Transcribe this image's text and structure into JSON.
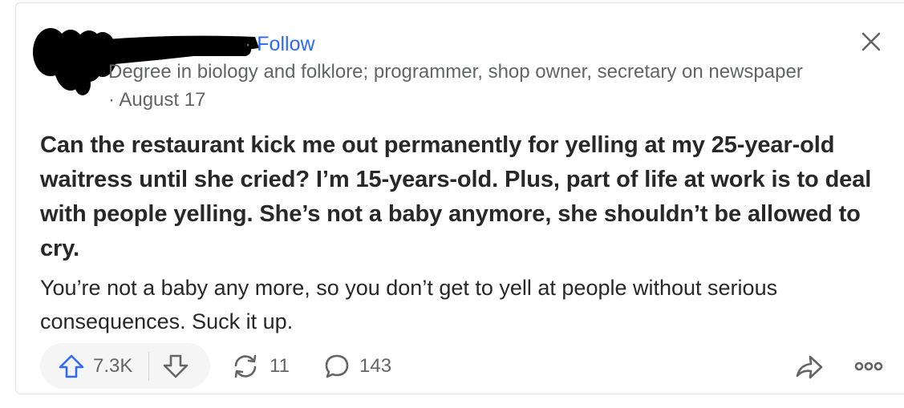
{
  "author": {
    "name_redacted": true,
    "separator": "·",
    "follow_label": "Follow",
    "credential": "Degree in biology and folklore; programmer, shop owner, secretary on newspaper",
    "date": "· August 17"
  },
  "question": {
    "text": "Can the restaurant kick me out permanently for yelling at my 25-year-old waitress until she cried? I’m 15-years-old. Plus, part of life at work is to deal with people yelling. She’s not a baby anymore, she shouldn’t be allowed to cry."
  },
  "answer": {
    "text": "You’re not a baby any more, so you don’t get to yell at people without serious consequences. Suck it up."
  },
  "actions": {
    "upvote_count": "7.3K",
    "reshare_count": "11",
    "comment_count": "143"
  },
  "icons": {
    "close": "close-icon",
    "upvote": "upvote-arrow-icon",
    "downvote": "downvote-arrow-icon",
    "reshare": "reshare-icon",
    "comment": "comment-bubble-icon",
    "share": "share-arrow-icon",
    "more": "more-options-icon"
  },
  "colors": {
    "accent": "#2e69ff",
    "text_primary": "#282829",
    "text_secondary": "#636466",
    "pill_bg": "#f5f5f5",
    "redaction": "#000000"
  }
}
